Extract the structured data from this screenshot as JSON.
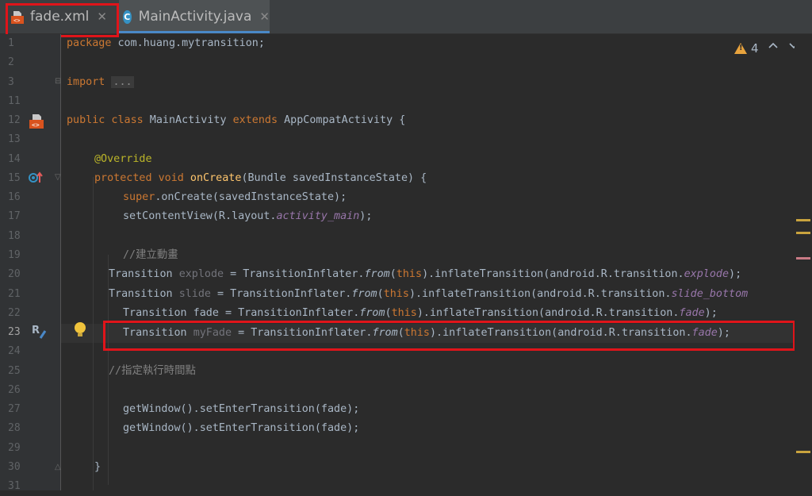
{
  "tabs": [
    {
      "label": "fade.xml",
      "close": "✕"
    },
    {
      "label": "MainActivity.java",
      "close": "✕"
    }
  ],
  "inspections": {
    "warning_count": "4",
    "prev": "⌃",
    "next": "⌄"
  },
  "gutter": {
    "line_numbers": [
      "1",
      "2",
      "3",
      "11",
      "12",
      "13",
      "14",
      "15",
      "16",
      "17",
      "18",
      "19",
      "20",
      "21",
      "22",
      "23",
      "24",
      "25",
      "26",
      "27",
      "28",
      "29",
      "30",
      "31"
    ],
    "r_marker": "R"
  },
  "code": {
    "l1_kw": "package",
    "l1_rest": " com.huang.mytransition;",
    "l3_kw": "import",
    "l3_fold": "...",
    "l12_kw1": "public class",
    "l12_name": " MainActivity ",
    "l12_kw2": "extends",
    "l12_rest": " AppCompatActivity {",
    "l14_ann": "@Override",
    "l15_kw": "protected void",
    "l15_fn": " onCreate",
    "l15_rest": "(Bundle savedInstanceState) {",
    "l16_kw": "super",
    "l16_rest": ".onCreate(savedInstanceState);",
    "l17_a": "setContentView(R.layout.",
    "l17_it": "activity_main",
    "l17_b": ");",
    "l19_cm": "//建立動畫",
    "l20_a": "Transition ",
    "l20_un": "explode",
    "l20_b": " = TransitionInflater.",
    "l20_from": "from",
    "l20_c": "(",
    "l20_this": "this",
    "l20_d": ").inflateTransition(android.R.transition.",
    "l20_it": "explode",
    "l20_e": ");",
    "l21_a": "Transition ",
    "l21_un": "slide",
    "l21_b": " = TransitionInflater.",
    "l21_from": "from",
    "l21_c": "(",
    "l21_this": "this",
    "l21_d": ").inflateTransition(android.R.transition.",
    "l21_it": "slide_bottom",
    "l22_a": "Transition fade = TransitionInflater.",
    "l22_from": "from",
    "l22_c": "(",
    "l22_this": "this",
    "l22_d": ").inflateTransition(android.R.transition.",
    "l22_it": "fade",
    "l22_e": ");",
    "l23_a": "Transition ",
    "l23_un": "myFade",
    "l23_b": " = TransitionInflater.",
    "l23_from": "from",
    "l23_c": "(",
    "l23_this": "this",
    "l23_d": ").inflateTransition(android.R.transition.",
    "l23_it": "fade",
    "l23_e": ");",
    "l25_cm": "//指定執行時間點",
    "l27": "getWindow().setEnterTransition(fade);",
    "l28": "getWindow().setEnterTransition(fade);",
    "l30": "}"
  },
  "colors": {
    "highlight": "#e0141a",
    "keyword": "#cc7832",
    "function": "#ffc66d",
    "static": "#9876aa",
    "comment": "#808080"
  }
}
